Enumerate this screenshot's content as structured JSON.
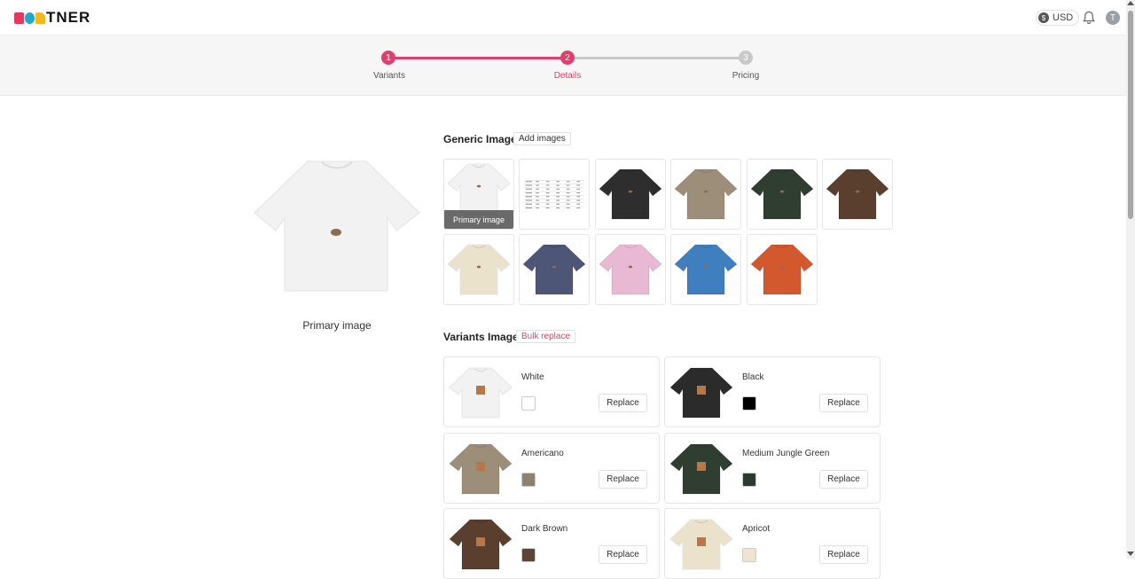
{
  "header": {
    "logo_text": "TNER",
    "logo_colors": [
      "#e03a62",
      "#1fa9c9",
      "#f3b720"
    ],
    "currency_label": "USD",
    "avatar_initial": "T"
  },
  "stepper": {
    "accent": "#d9426f",
    "steps": [
      {
        "number": "1",
        "label": "Variants",
        "state": "done"
      },
      {
        "number": "2",
        "label": "Details",
        "state": "active"
      },
      {
        "number": "3",
        "label": "Pricing",
        "state": "todo"
      }
    ]
  },
  "preview": {
    "caption": "Primary image",
    "shirt_color": "#f2f2f2"
  },
  "generic_images": {
    "title": "Generic Images",
    "add_button": "Add images",
    "primary_tag": "Primary image",
    "tiles": [
      {
        "kind": "shirt",
        "color": "#f2f2f2",
        "primary": true
      },
      {
        "kind": "size-chart",
        "color": "#ffffff"
      },
      {
        "kind": "shirt",
        "color": "#2e2e2e"
      },
      {
        "kind": "shirt",
        "color": "#9c8e78"
      },
      {
        "kind": "shirt",
        "color": "#2f3e30"
      },
      {
        "kind": "shirt",
        "color": "#5a3e2e"
      },
      {
        "kind": "shirt",
        "color": "#ebe2cc"
      },
      {
        "kind": "shirt",
        "color": "#4d5677"
      },
      {
        "kind": "shirt",
        "color": "#e9b9d4"
      },
      {
        "kind": "shirt",
        "color": "#3f7fbf"
      },
      {
        "kind": "shirt",
        "color": "#d3582e"
      }
    ]
  },
  "variant_images": {
    "title": "Variants Images",
    "bulk_button": "Bulk replace",
    "replace_label": "Replace",
    "variants": [
      {
        "name": "White",
        "color": "#f2f2f2",
        "swatch": "#ffffff"
      },
      {
        "name": "Black",
        "color": "#2b2b2b",
        "swatch": "#000000"
      },
      {
        "name": "Americano",
        "color": "#9c8e78",
        "swatch": "#8d8170"
      },
      {
        "name": "Medium Jungle Green",
        "color": "#2f3e30",
        "swatch": "#2c3a30"
      },
      {
        "name": "Dark Brown",
        "color": "#5a3e2e",
        "swatch": "#5c4536"
      },
      {
        "name": "Apricot",
        "color": "#ebe2cc",
        "swatch": "#efe4d2"
      }
    ]
  }
}
